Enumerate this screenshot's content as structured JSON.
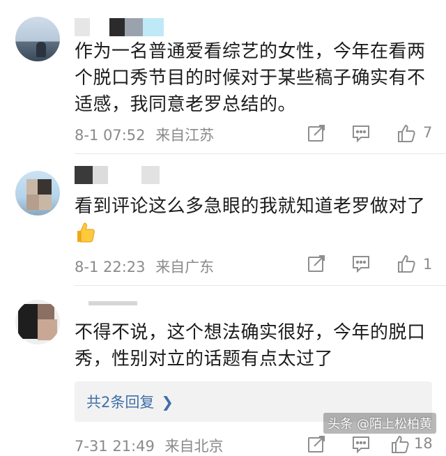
{
  "comments": [
    {
      "text": "作为一名普通爱看综艺的女性，今年在看两个脱口秀节目的时候对于某些稿子确实有不适感，我同意老罗总结的。",
      "time": "8-1 07:52",
      "location": "来自江苏",
      "likes": "7"
    },
    {
      "text": "看到评论这么多急眼的我就知道老罗做对了",
      "emoji": "thumbs-up-emoji",
      "time": "8-1 22:23",
      "location": "来自广东",
      "likes": "1"
    },
    {
      "text": "不得不说，这个想法确实很好，今年的脱口秀，性别对立的话题有点太过了",
      "replies_label": "共2条回复",
      "time": "7-31 21:49",
      "location": "来自北京",
      "likes": "18"
    }
  ],
  "icons": {
    "repost": "share-edit-icon",
    "comment": "comment-icon",
    "like": "thumbs-up-icon",
    "chevron": "chevron-right-icon"
  },
  "watermark": "头条 @陌上松柏黄",
  "colors": {
    "link": "#3f6fa8",
    "meta": "#8a8a8a",
    "reply_bg": "#f2f2f2"
  }
}
